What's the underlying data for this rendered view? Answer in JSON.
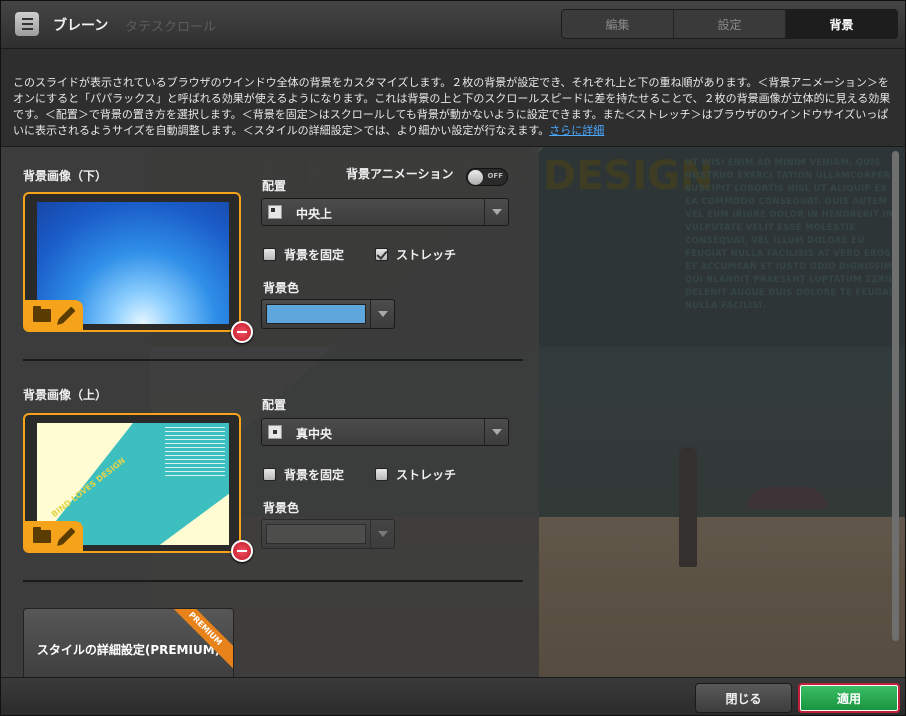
{
  "header": {
    "title": "ブレーン",
    "scroll_label": "タテスクロール",
    "tabs": [
      {
        "label": "編集"
      },
      {
        "label": "設定"
      },
      {
        "label": "背景"
      }
    ]
  },
  "description": {
    "text": "このスライドが表示されているブラウザのウインドウ全体の背景をカスタマイズします。２枚の背景が設定でき、それぞれ上と下の重ね順があります。＜背景アニメーション＞をオンにすると「パパラックス」と呼ばれる効果が使えるようになります。これは背景の上と下のスクロールスピードに差を持たせることで、２枚の背景画像が立体的に見える効果です。＜配置＞で背景の置き方を選択します。＜背景を固定＞はスクロールしても背景が動かないように設定できます。また＜ストレッチ＞はブラウザのウインドウサイズいっぱいに表示されるようサイズを自動調整します。＜スタイルの詳細設定＞では、より細かい設定が行なえます。",
    "link": "さらに詳細"
  },
  "preview": {
    "logo_text": "BIND LOVES DESIGN",
    "body_text": "UT WISI ENIM AD MINIM VENIAM, QUIS NOSTRUD EXERCI TATION ULLAMCORPER SUSCIPIT LOBORTIS NISL UT ALIQUIP EX EA COMMODO CONSEQUAT. DUIS AUTEM VEL EUM IRIURE DOLOR IN HENDRERIT IN VULPUTATE VELIT ESSE MOLESTIE CONSEQUAT, VEL ILLUM DOLORE EU FEUGIAT NULLA FACILISIS AT VERO EROS ET ACCUMSAN ET IUSTO ODIO DIGNISSIM QUI BLANDIT PRAESENT LUPTATUM ZZRIL DELENIT AUGUE DUIS DOLORE TE FEUGAIT NULLA FACILISI."
  },
  "background_animation": {
    "label": "背景アニメーション",
    "state": "OFF"
  },
  "lower": {
    "section_label": "背景画像（下）",
    "placement_label": "配置",
    "placement_value": "中央上",
    "fix_label": "背景を固定",
    "fix_checked": false,
    "stretch_label": "ストレッチ",
    "stretch_checked": true,
    "color_label": "背景色",
    "color_value": "#5ea7dc"
  },
  "upper": {
    "section_label": "背景画像（上）",
    "placement_label": "配置",
    "placement_value": "真中央",
    "fix_label": "背景を固定",
    "fix_checked": false,
    "stretch_label": "ストレッチ",
    "stretch_checked": false,
    "color_label": "背景色",
    "color_value": "#5a5a5a",
    "thumb_logo": "BIND LOVES DESIGN"
  },
  "premium": {
    "label": "スタイルの詳細設定(PREMIUM)",
    "ribbon": "PREMIUM"
  },
  "footer": {
    "close_label": "閉じる",
    "apply_label": "適用"
  },
  "colors": {
    "accent_orange": "#f5a31a",
    "apply_green": "#2aa852",
    "remove_red": "#d82a3a"
  }
}
